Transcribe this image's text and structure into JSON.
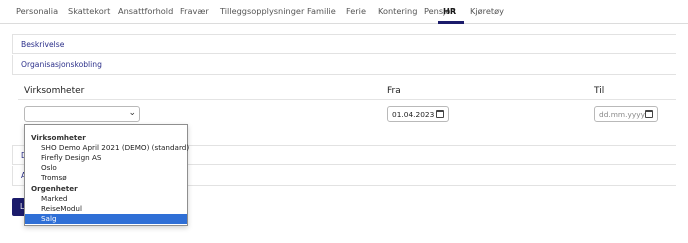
{
  "tabs": [
    {
      "label": "Personalia"
    },
    {
      "label": "Skattekort"
    },
    {
      "label": "Ansattforhold"
    },
    {
      "label": "Fravær"
    },
    {
      "label": "Tilleggsopplysninger"
    },
    {
      "label": "Familie"
    },
    {
      "label": "Ferie"
    },
    {
      "label": "Kontering"
    },
    {
      "label": "Pensjon"
    },
    {
      "label": "HR",
      "active": true
    },
    {
      "label": "Kjøretøy"
    }
  ],
  "sections": {
    "beskrivelse": "Beskrivelse",
    "organisasjonskobling": "Organisasjonskobling"
  },
  "columns": {
    "virksomheter": "Virksomheter",
    "fra": "Fra",
    "til": "Til"
  },
  "fields": {
    "virksomhet_value": "",
    "fra_value": "01.04.2023",
    "til_placeholder": "dd.mm.yyyy"
  },
  "lower_rows": {
    "row_d": "D",
    "row_a": "A"
  },
  "action_button": {
    "label": "L"
  },
  "dropdown": {
    "groups": [
      {
        "label": "Virksomheter",
        "options": [
          "SHO Demo April 2021 (DEMO) (standard)",
          "Firefly Design AS",
          "Oslo",
          "Tromsø"
        ]
      },
      {
        "label": "Orgenheter",
        "options": [
          "Marked",
          "ReiseModul",
          "Salg"
        ]
      }
    ],
    "selected": "Salg"
  },
  "colors": {
    "accent": "#1b1b6b",
    "link": "#2b2f8a",
    "selection": "#2f6fd6"
  }
}
